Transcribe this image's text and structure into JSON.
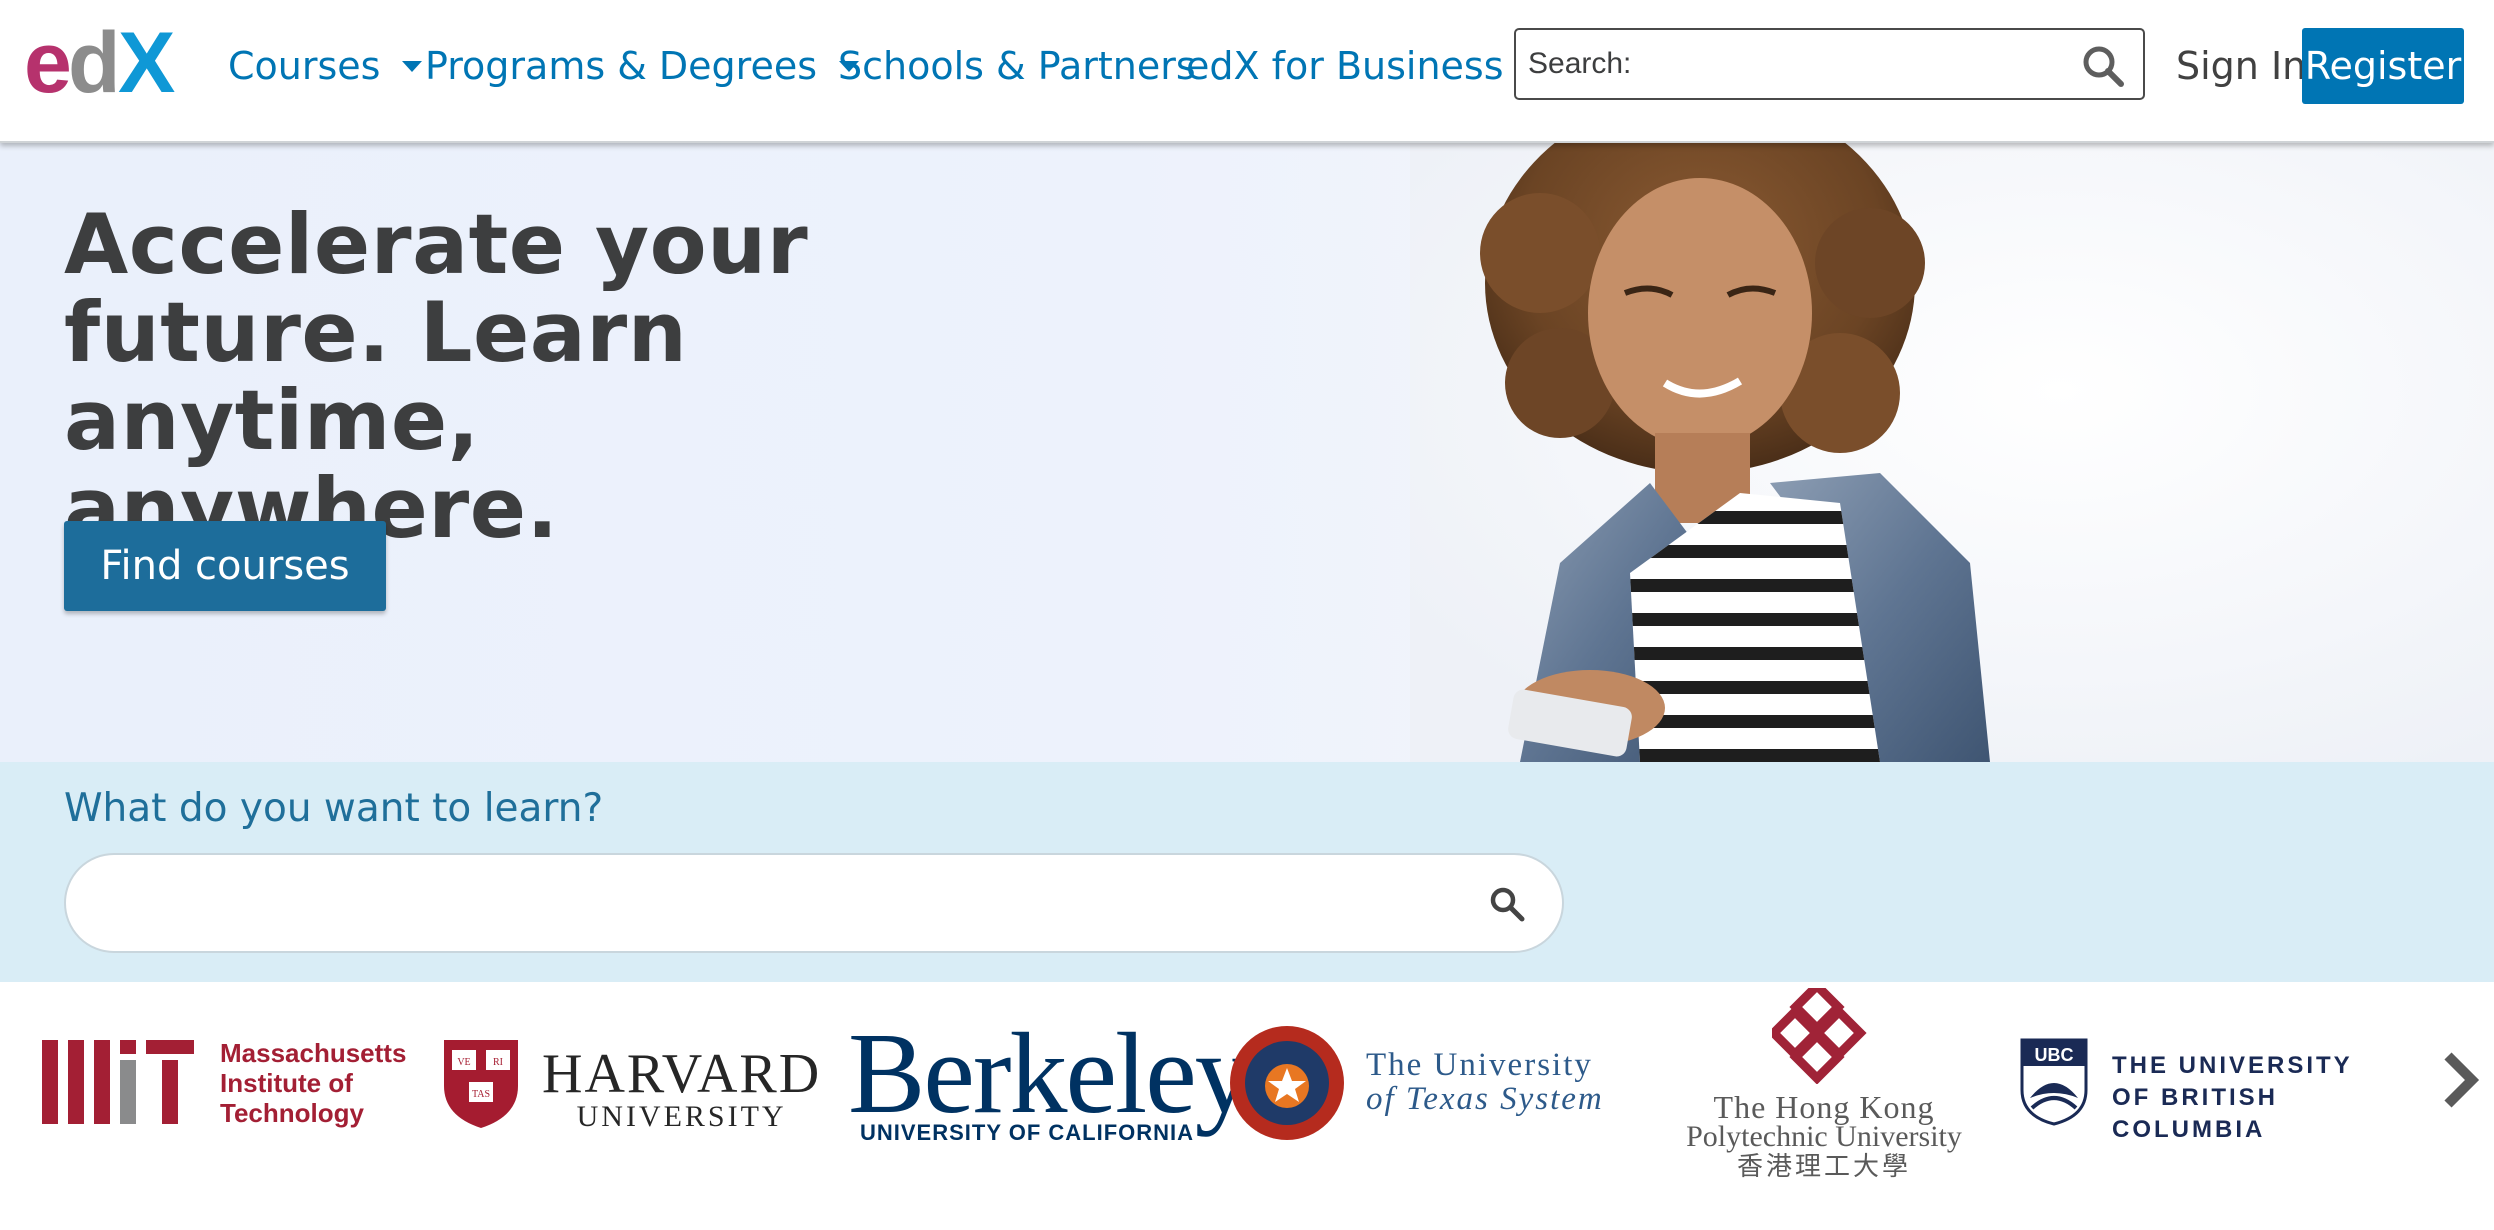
{
  "header": {
    "logo": {
      "text_e": "e",
      "text_d": "d",
      "text_x": "X"
    },
    "nav": [
      {
        "label": "Courses",
        "has_dropdown": true
      },
      {
        "label": "Programs & Degrees",
        "has_dropdown": true
      },
      {
        "label": "Schools & Partners",
        "has_dropdown": false
      },
      {
        "label": "edX for Business",
        "has_dropdown": false
      }
    ],
    "search_placeholder": "Search:",
    "sign_in_label": "Sign In",
    "register_label": "Register"
  },
  "hero": {
    "title": "Accelerate your future. Learn anytime, anywhere.",
    "cta_label": "Find courses"
  },
  "learn": {
    "label": "What do you want to learn?",
    "input_value": ""
  },
  "partners": {
    "mit": {
      "line1": "Massachusetts",
      "line2": "Institute of",
      "line3": "Technology"
    },
    "harvard": {
      "line1": "HARVARD",
      "line2": "UNIVERSITY",
      "shield_top_left": "VE",
      "shield_top_right": "RI",
      "shield_bottom": "TAS"
    },
    "berkeley": {
      "line1": "Berkeley",
      "line2": "UNIVERSITY OF CALIFORNIA"
    },
    "texas": {
      "line1": "The University",
      "line2": "of Texas System"
    },
    "polyu": {
      "line1": "The Hong Kong",
      "line2": "Polytechnic University",
      "line3": "香港理工大學"
    },
    "ubc": {
      "badge": "UBC",
      "line1": "THE UNIVERSITY",
      "line2": "OF BRITISH COLUMBIA"
    }
  },
  "colors": {
    "brand_blue": "#0075b4",
    "cta_blue": "#1d6d9b",
    "edx_magenta": "#b6326d",
    "mit_red": "#a31f34",
    "berkeley_navy": "#003262",
    "learn_band": "#d9edf6"
  },
  "icons": {
    "header_search": "search-icon",
    "learn_search": "search-icon",
    "carousel_next": "chevron-right-icon",
    "nav_dropdown": "caret-down-icon"
  }
}
